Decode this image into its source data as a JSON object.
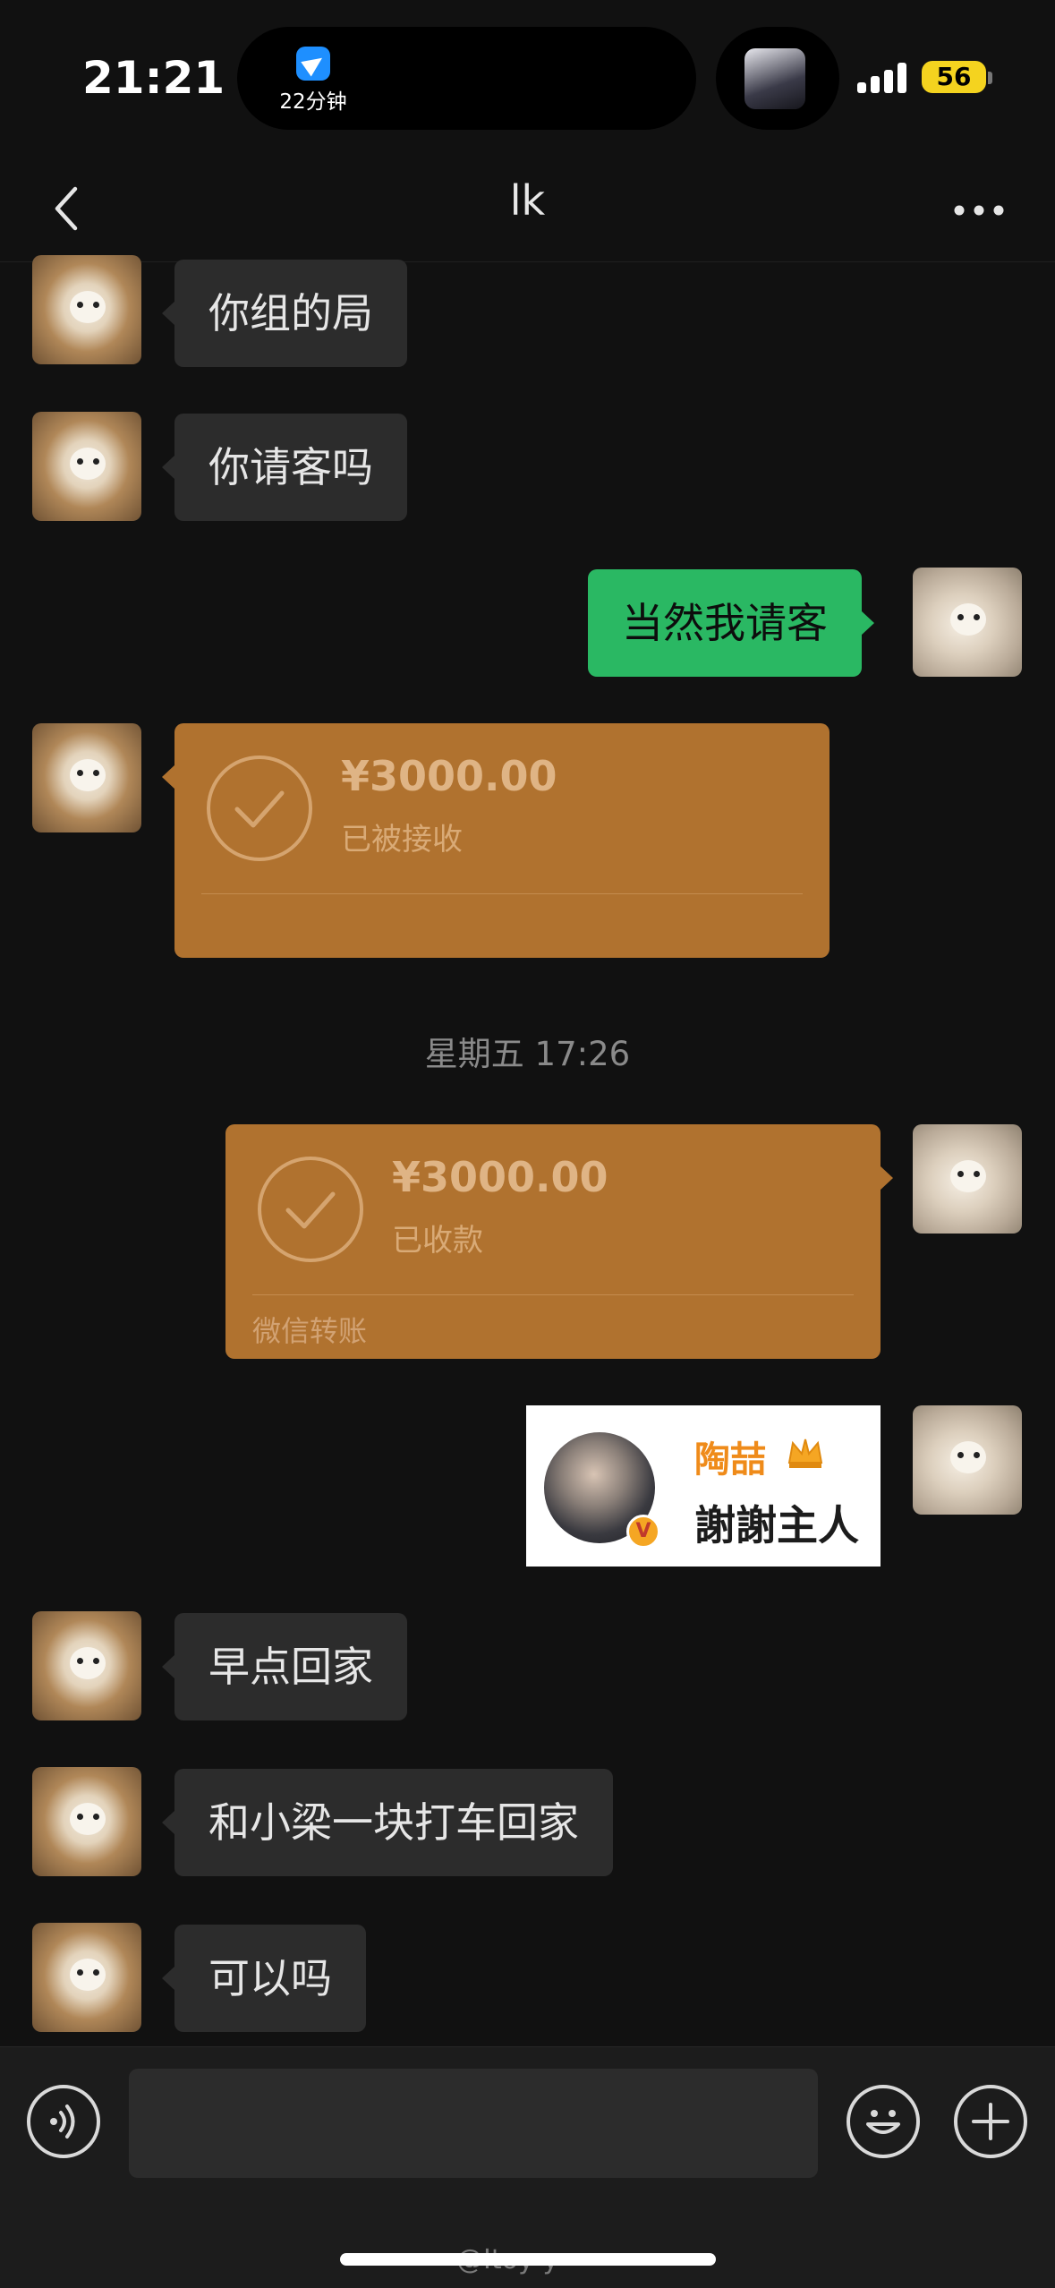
{
  "status_bar": {
    "time": "21:21",
    "activity_text": "22分钟",
    "battery": "56"
  },
  "nav": {
    "title": "lk",
    "back_icon": "chevron-left-icon",
    "more_icon": "more-dots-icon"
  },
  "messages": [
    {
      "side": "in",
      "type": "text",
      "text": "你组的局"
    },
    {
      "side": "in",
      "type": "text",
      "text": "你请客吗"
    },
    {
      "side": "out",
      "type": "text",
      "text": "当然我请客"
    },
    {
      "side": "in",
      "type": "transfer",
      "amount": "¥3000.00",
      "status": "已被接收",
      "footer": ""
    },
    {
      "type": "timestamp",
      "text": "星期五 17:26"
    },
    {
      "side": "out",
      "type": "transfer",
      "amount": "¥3000.00",
      "status": "已收款",
      "footer": "微信转账"
    },
    {
      "side": "out",
      "type": "sticker",
      "name": "陶喆",
      "text": "謝謝主人",
      "badge": "V"
    },
    {
      "side": "in",
      "type": "text",
      "text": "早点回家"
    },
    {
      "side": "in",
      "type": "text",
      "text": "和小梁一块打车回家"
    },
    {
      "side": "in",
      "type": "text",
      "text": "可以吗"
    }
  ],
  "input_bar": {
    "voice_icon": "voice-icon",
    "emoji_icon": "emoji-icon",
    "plus_icon": "plus-icon",
    "value": ""
  },
  "watermark": "@Itoy-y",
  "colors": {
    "background": "#111111",
    "incoming_bubble": "#2c2c2c",
    "outgoing_bubble": "#2ab863",
    "transfer_card": "#b0722f",
    "battery": "#f4d31f"
  }
}
